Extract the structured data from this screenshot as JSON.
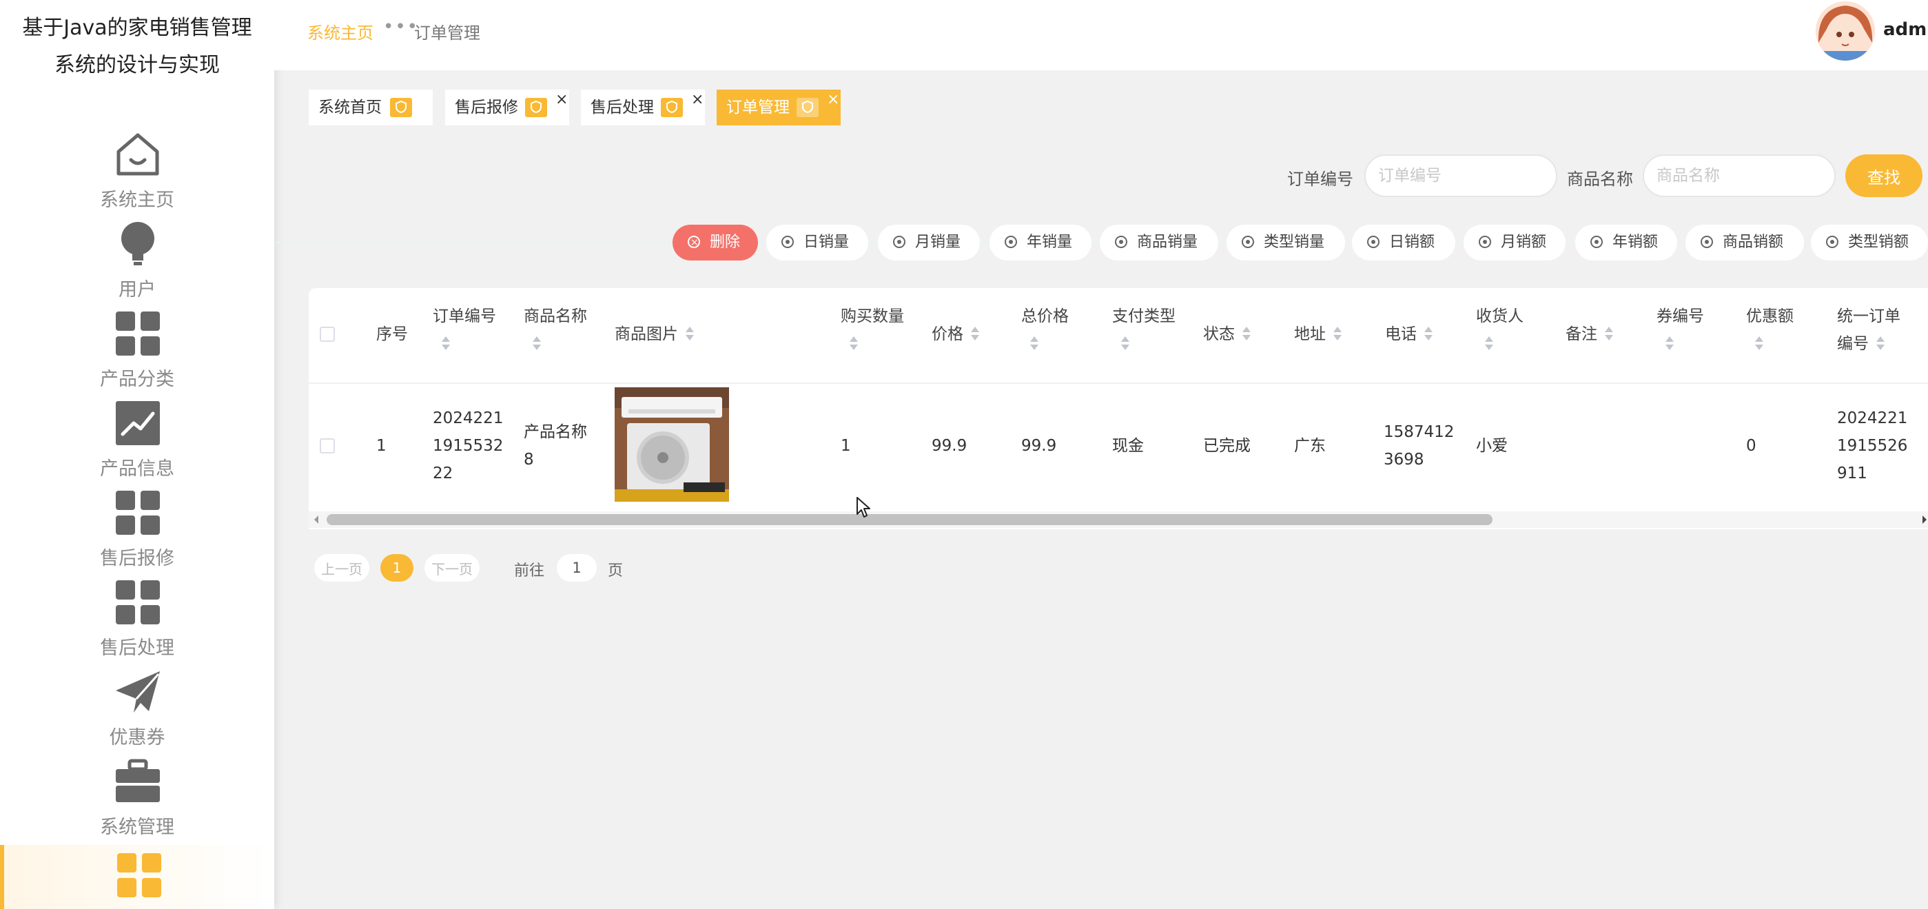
{
  "app": {
    "title_line1": "基于Java的家电销售管理",
    "title_line2": "系统的设计与实现"
  },
  "sidebar": {
    "items": [
      {
        "label": "系统主页",
        "icon": "home-icon"
      },
      {
        "label": "用户",
        "icon": "bulb-icon"
      },
      {
        "label": "产品分类",
        "icon": "grid-icon"
      },
      {
        "label": "产品信息",
        "icon": "chart-icon"
      },
      {
        "label": "售后报修",
        "icon": "grid-icon"
      },
      {
        "label": "售后处理",
        "icon": "grid-icon"
      },
      {
        "label": "优惠券",
        "icon": "paper-plane-icon"
      },
      {
        "label": "系统管理",
        "icon": "briefcase-icon"
      },
      {
        "label": "",
        "icon": "grid-icon",
        "active": true
      }
    ],
    "accent": "#f9b934"
  },
  "header": {
    "breadcrumb_home": "系统主页",
    "breadcrumb_sep": "•••",
    "breadcrumb_current": "订单管理",
    "user": "admin"
  },
  "tabs": [
    {
      "label": "系统首页",
      "closable": false
    },
    {
      "label": "售后报修",
      "closable": true,
      "close": "×"
    },
    {
      "label": "售后处理",
      "closable": true,
      "close": "×"
    },
    {
      "label": "订单管理",
      "closable": true,
      "close": "×",
      "active": true
    }
  ],
  "search": {
    "order_label": "订单编号",
    "order_placeholder": "订单编号",
    "order_value": "",
    "product_label": "商品名称",
    "product_placeholder": "商品名称",
    "product_value": "",
    "button": "查找"
  },
  "actions": [
    "删除",
    "日销量",
    "月销量",
    "年销量",
    "商品销量",
    "类型销量",
    "日销额",
    "月销额",
    "年销额",
    "商品销额",
    "类型销额"
  ],
  "table": {
    "headers": {
      "index": "序号",
      "order_no_1": "订单编号",
      "product_name": "商品名称",
      "product_image": "商品图片",
      "quantity": "购买数量",
      "price": "价格",
      "total_price": "总价格",
      "pay_type": "支付类型",
      "status": "状态",
      "address": "地址",
      "phone": "电话",
      "receiver": "收货人",
      "remark": "备注",
      "coupon_no": "券编号",
      "discount": "优惠额",
      "unified_1": "统一订单",
      "unified_2": "编号"
    },
    "rows": [
      {
        "index": "1",
        "order_no_l1": "2024221",
        "order_no_l2": "1915532",
        "order_no_l3": "22",
        "product_name_l1": "产品名称",
        "product_name_l2": "8",
        "image_caption": "商品图片",
        "quantity": "1",
        "price": "99.9",
        "total_price": "99.9",
        "pay_type": "现金",
        "status": "已完成",
        "address": "广东",
        "phone_l1": "1587412",
        "phone_l2": "3698",
        "receiver": "小爱",
        "remark": "",
        "coupon_no": "",
        "discount": "0",
        "unified_l1": "2024221",
        "unified_l2": "1915526",
        "unified_l3": "911"
      }
    ]
  },
  "pagination": {
    "prev": "上一页",
    "current": "1",
    "next": "下一页",
    "goto": "前往",
    "page_input": "1",
    "page_unit": "页"
  }
}
